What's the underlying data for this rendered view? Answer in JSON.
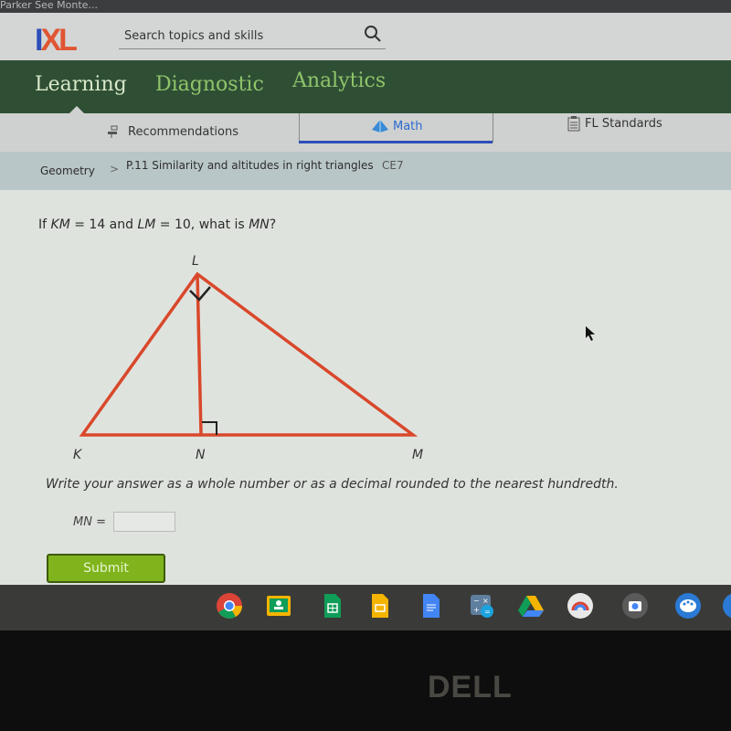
{
  "window": {
    "title": "Parker See Monte..."
  },
  "header": {
    "logo_i": "I",
    "logo_xl": "XL",
    "search_placeholder": "Search topics and skills",
    "search_icon": "search-icon"
  },
  "nav": {
    "items": [
      {
        "label": "Learning",
        "active": true
      },
      {
        "label": "Diagnostic",
        "active": false
      },
      {
        "label": "Analytics",
        "active": false
      }
    ]
  },
  "subnav": {
    "items": [
      {
        "label": "Recommendations",
        "icon": "recommendations-icon"
      },
      {
        "label": "Math",
        "icon": "pyramid-icon",
        "active": true
      },
      {
        "label": "FL Standards",
        "icon": "clipboard-icon"
      }
    ]
  },
  "breadcrumb": {
    "subject": "Geometry",
    "separator": ">",
    "skill": "P.11 Similarity and altitudes in right triangles",
    "code": "CE7"
  },
  "question": {
    "prefix": "If ",
    "var1": "KM",
    "eq1": " = 14 and ",
    "var2": "LM",
    "eq2": " = 10, what is ",
    "var3": "MN",
    "suffix": "?"
  },
  "diagram": {
    "labels": {
      "L": "L",
      "K": "K",
      "N": "N",
      "M": "M"
    },
    "line_color": "#d9482b"
  },
  "instruction": "Write your answer as a whole number or as a decimal rounded to the nearest hundredth.",
  "answer": {
    "label": "MN =",
    "value": "",
    "placeholder": ""
  },
  "submit_label": "Submit",
  "shelf": {
    "apps": [
      "chrome-icon",
      "classroom-icon",
      "sheets-icon",
      "slides-icon",
      "docs-icon",
      "calculator-icon",
      "drive-icon",
      "chrome-web-store-icon",
      "camera-icon",
      "canvas-icon"
    ]
  },
  "bezel": {
    "brand": "DELL"
  },
  "colors": {
    "nav_bg": "#2f4f35",
    "accent_green": "#8fc46a",
    "submit_green": "#7fb41c",
    "math_blue": "#2d6ad0"
  }
}
